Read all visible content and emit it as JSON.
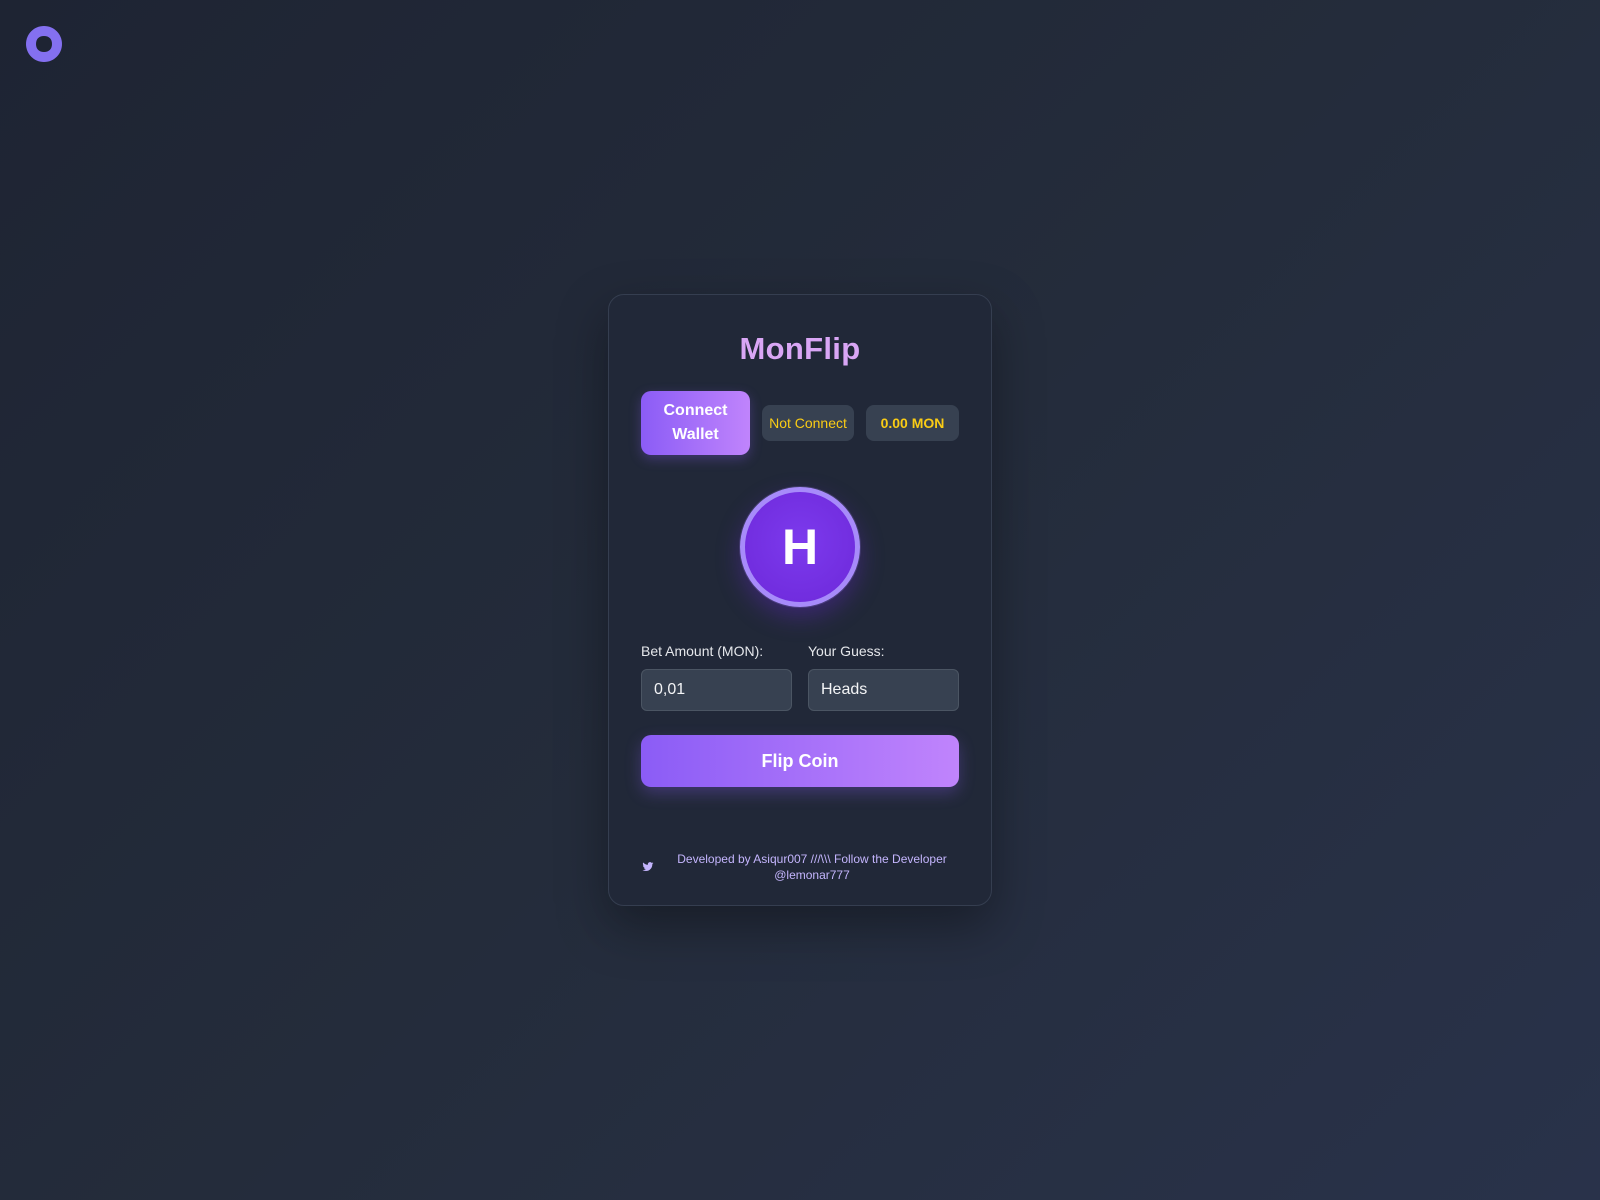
{
  "app": {
    "logo_icon": "monad-logo-icon",
    "accent_color": "#8b5cf6",
    "title": "MonFlip"
  },
  "wallet": {
    "connect_label_line1": "Connect",
    "connect_label_line2": "Wallet",
    "status": "Not Connect",
    "balance": "0.00 MON"
  },
  "coin": {
    "face": "H"
  },
  "form": {
    "bet_label": "Bet Amount (MON):",
    "bet_value": "0,01",
    "guess_label": "Your Guess:",
    "guess_value": "Heads"
  },
  "actions": {
    "flip_label": "Flip Coin"
  },
  "footer": {
    "icon": "twitter-icon",
    "line1": "Developed by Asiqur007 ///\\\\\\ Follow the Developer",
    "line2": "@lemonar777"
  }
}
